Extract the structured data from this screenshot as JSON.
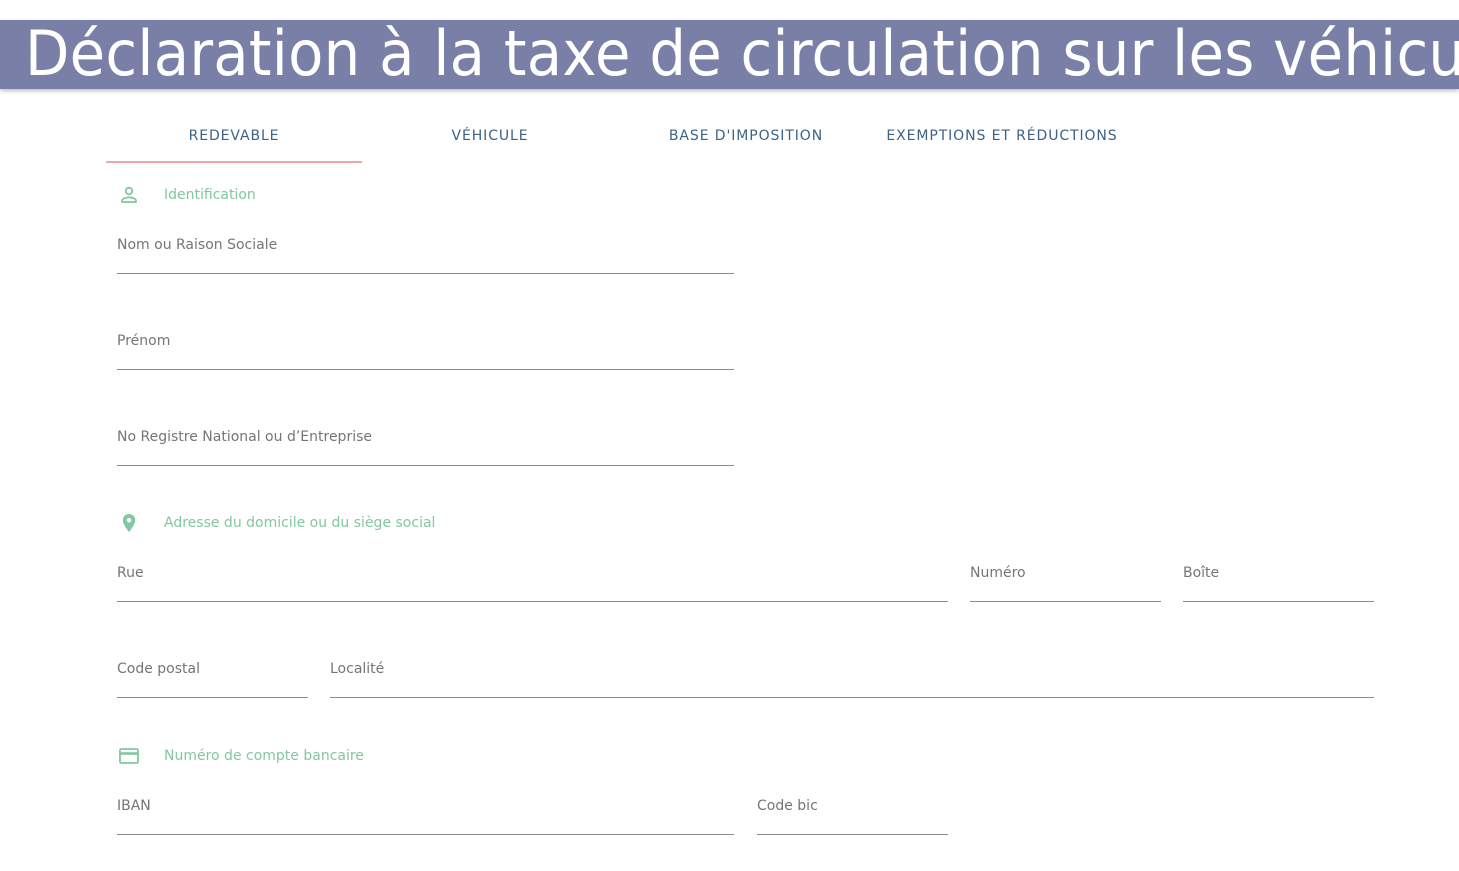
{
  "header": {
    "title": "Déclaration à la taxe de circulation sur les véhicules"
  },
  "tabs": [
    {
      "label": "REDEVABLE",
      "active": true
    },
    {
      "label": "VÉHICULE",
      "active": false
    },
    {
      "label": "BASE D'IMPOSITION",
      "active": false
    },
    {
      "label": "EXEMPTIONS ET RÉDUCTIONS",
      "active": false
    }
  ],
  "sections": {
    "identification": {
      "label": "Identification",
      "icon": "person-icon",
      "fields": {
        "name": "Nom ou Raison Sociale",
        "firstname": "Prénom",
        "registry": "No Registre National ou d’Entreprise"
      }
    },
    "address": {
      "label": "Adresse du domicile ou du siège social",
      "icon": "location-pin-icon",
      "fields": {
        "street": "Rue",
        "number": "Numéro",
        "box": "Boîte",
        "postal_code": "Code postal",
        "city": "Localité"
      }
    },
    "bank": {
      "label": "Numéro de compte bancaire",
      "icon": "credit-card-icon",
      "fields": {
        "iban": "IBAN",
        "bic": "Code bic"
      }
    }
  },
  "colors": {
    "header_bg": "#7a7fa8",
    "tab_text": "#3c6287",
    "tab_indicator": "#f1a6a6",
    "section_accent": "#82c7a0"
  }
}
